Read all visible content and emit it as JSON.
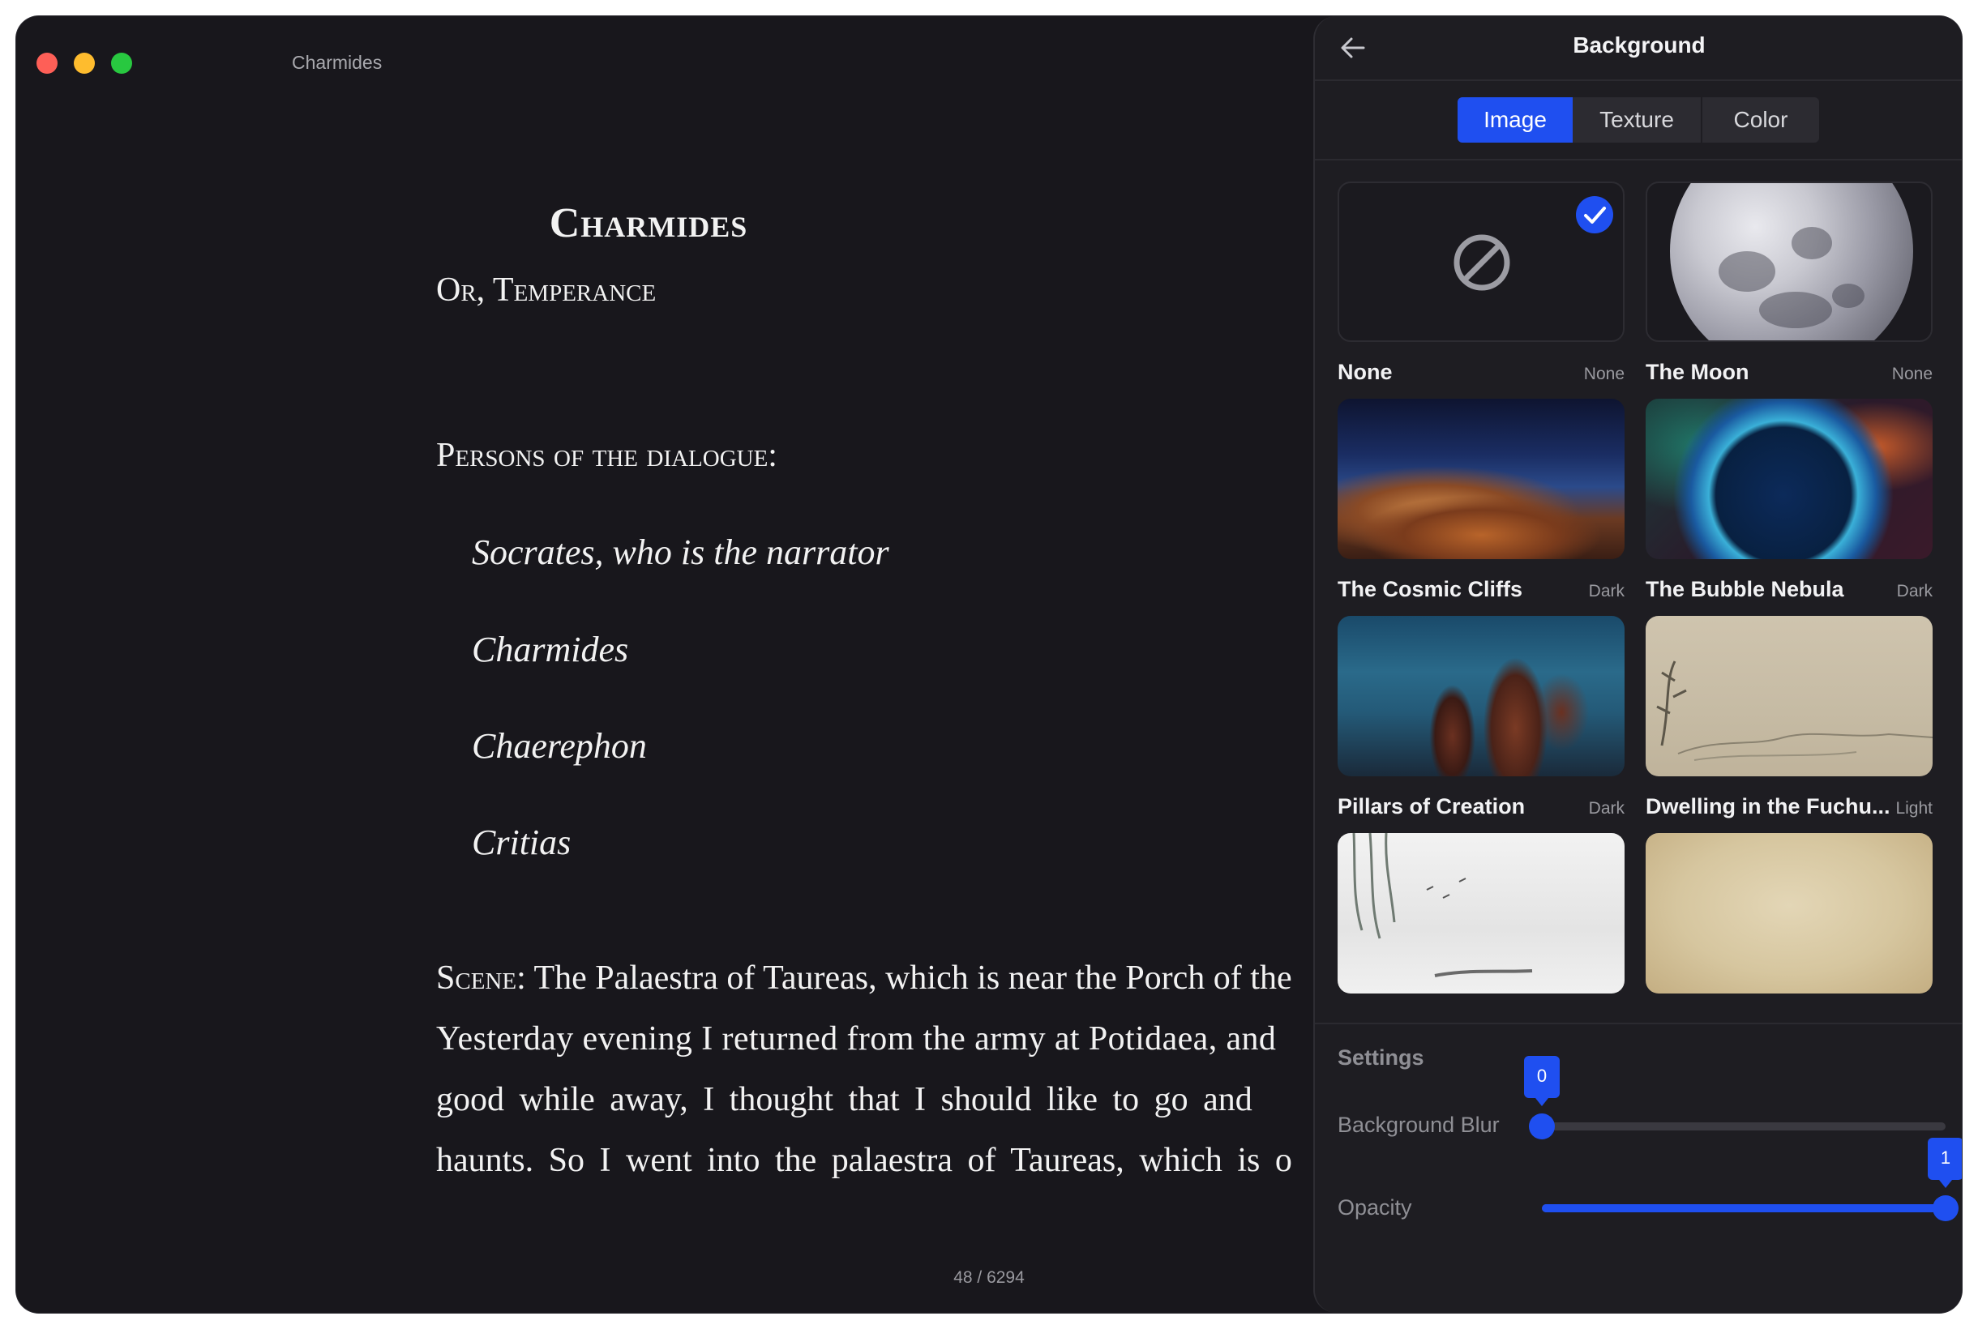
{
  "window": {
    "title": "Charmides"
  },
  "reader": {
    "book_title": "Charmides",
    "subtitle": "Or, Temperance",
    "persons_heading": "Persons of the dialogue:",
    "persons": [
      "Socrates, who is the narrator",
      "Charmides",
      "Chaerephon",
      "Critias"
    ],
    "scene_label": "Scene:",
    "scene_lines": [
      " The Palaestra of Taureas, which is near the Porch of the",
      "Yesterday evening I returned from the army at Potidaea, and",
      "good while away, I thought that I should like to go and",
      "haunts. So I went into the palaestra of Taureas, which is o"
    ],
    "page_counter": "48 / 6294"
  },
  "panel": {
    "title": "Background",
    "tabs": [
      {
        "label": "Image",
        "active": true
      },
      {
        "label": "Texture",
        "active": false
      },
      {
        "label": "Color",
        "active": false
      }
    ],
    "cards": [
      {
        "name": "None",
        "tag": "None",
        "selected": true,
        "icon": "prohibited-icon"
      },
      {
        "name": "The Moon",
        "tag": "None",
        "selected": false
      },
      {
        "name": "The Cosmic Cliffs",
        "tag": "Dark",
        "selected": false
      },
      {
        "name": "The Bubble Nebula",
        "tag": "Dark",
        "selected": false
      },
      {
        "name": "Pillars of Creation",
        "tag": "Dark",
        "selected": false
      },
      {
        "name": "Dwelling in the Fuchu...",
        "tag": "Light",
        "selected": false
      },
      {
        "name": "",
        "tag": "",
        "selected": false
      },
      {
        "name": "",
        "tag": "",
        "selected": false
      }
    ],
    "settings": {
      "label": "Settings",
      "blur": {
        "label": "Background Blur",
        "value": "0",
        "fraction": 0
      },
      "opacity": {
        "label": "Opacity",
        "value": "1",
        "fraction": 1
      }
    }
  },
  "colors": {
    "accent": "#1f4ff0",
    "background": "#18171c",
    "panel": "#1e1d22"
  }
}
